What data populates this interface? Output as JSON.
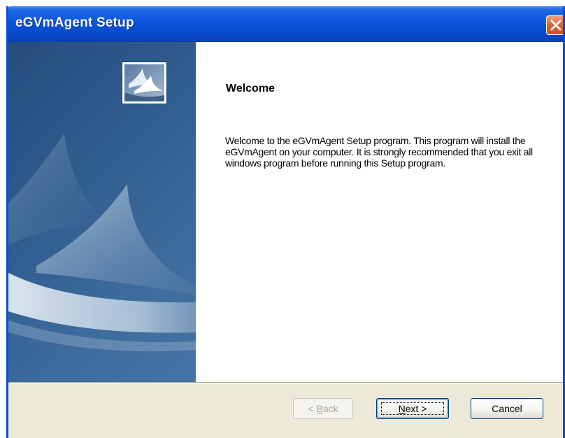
{
  "window": {
    "title": "eGVmAgent Setup"
  },
  "titlebar": {
    "close_icon": "close-x-icon"
  },
  "sidebar": {
    "logo_icon": "setup-sail-logo-icon",
    "colors": {
      "background": "#2f5b8c",
      "swoosh": "#d8e3ee"
    }
  },
  "content": {
    "heading": "Welcome",
    "body": "Welcome to the eGVmAgent Setup program. This program will install the eGVmAgent on your computer. It is strongly recommended that you exit all windows program before running this Setup program."
  },
  "buttons": {
    "back": {
      "mnemonic_prefix": "< ",
      "mnemonic": "B",
      "rest": "ack",
      "enabled": false
    },
    "next": {
      "mnemonic": "N",
      "rest": "ext >",
      "enabled": true
    },
    "cancel": {
      "label": "Cancel",
      "enabled": true
    }
  },
  "colors": {
    "titlebar": "#0a55dc",
    "close": "#e06a3e",
    "dialog": "#ece9d8"
  }
}
